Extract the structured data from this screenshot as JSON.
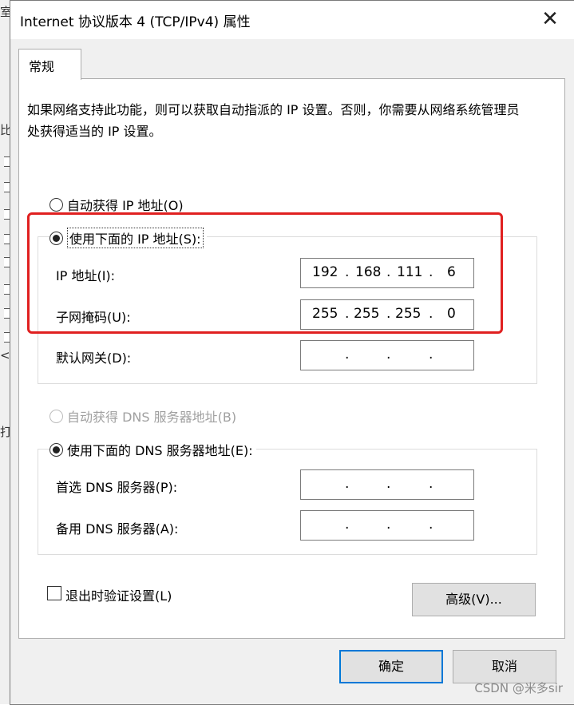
{
  "background_window": {
    "fragments": [
      "室",
      "比",
      "<",
      "打"
    ]
  },
  "window": {
    "title": "Internet 协议版本 4 (TCP/IPv4) 属性",
    "close_glyph": "✕"
  },
  "tabs": [
    {
      "label": "常规"
    }
  ],
  "intro_text": "如果网络支持此功能，则可以获取自动指派的 IP 设置。否则，你需要从网络系统管理员处获得适当的 IP 设置。",
  "ip_section": {
    "auto_option": "自动获得 IP 地址(O)",
    "manual_option": "使用下面的 IP 地址(S):",
    "selected": "manual",
    "fields": [
      {
        "label": "IP 地址(I):",
        "octets": [
          "192",
          "168",
          "111",
          "6"
        ]
      },
      {
        "label": "子网掩码(U):",
        "octets": [
          "255",
          "255",
          "255",
          "0"
        ]
      },
      {
        "label": "默认网关(D):",
        "octets": [
          "",
          "",
          "",
          ""
        ]
      }
    ]
  },
  "dns_section": {
    "auto_option": "自动获得 DNS 服务器地址(B)",
    "manual_option": "使用下面的 DNS 服务器地址(E):",
    "selected": "manual",
    "fields": [
      {
        "label": "首选 DNS 服务器(P):",
        "octets": [
          "",
          "",
          "",
          ""
        ]
      },
      {
        "label": "备用 DNS 服务器(A):",
        "octets": [
          "",
          "",
          "",
          ""
        ]
      }
    ]
  },
  "validate_on_exit": {
    "label": "退出时验证设置(L)",
    "checked": false
  },
  "buttons": {
    "advanced": "高级(V)...",
    "ok": "确定",
    "cancel": "取消"
  },
  "watermark": "CSDN @米多sir",
  "colors": {
    "highlight_box": "#e02020",
    "default_button_border": "#0078d7"
  }
}
